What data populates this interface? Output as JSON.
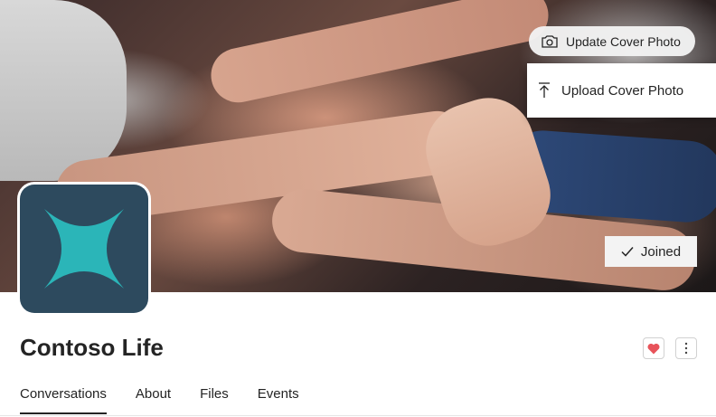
{
  "cover": {
    "update_button_label": "Update Cover Photo",
    "camera_icon": "camera-icon",
    "menu": {
      "upload_label": "Upload Cover Photo",
      "upload_icon": "upload-icon"
    },
    "joined_label": "Joined",
    "check_icon": "checkmark-icon"
  },
  "group": {
    "name": "Contoso Life",
    "logo_icon": "four-point-star-icon",
    "logo_bg": "#2d4a5e",
    "logo_fg": "#2bb5b8",
    "favorite_icon": "heart-icon",
    "favorite_color": "#e8535a",
    "more_icon": "more-vertical-icon"
  },
  "tabs": [
    {
      "label": "Conversations",
      "active": true
    },
    {
      "label": "About",
      "active": false
    },
    {
      "label": "Files",
      "active": false
    },
    {
      "label": "Events",
      "active": false
    }
  ]
}
